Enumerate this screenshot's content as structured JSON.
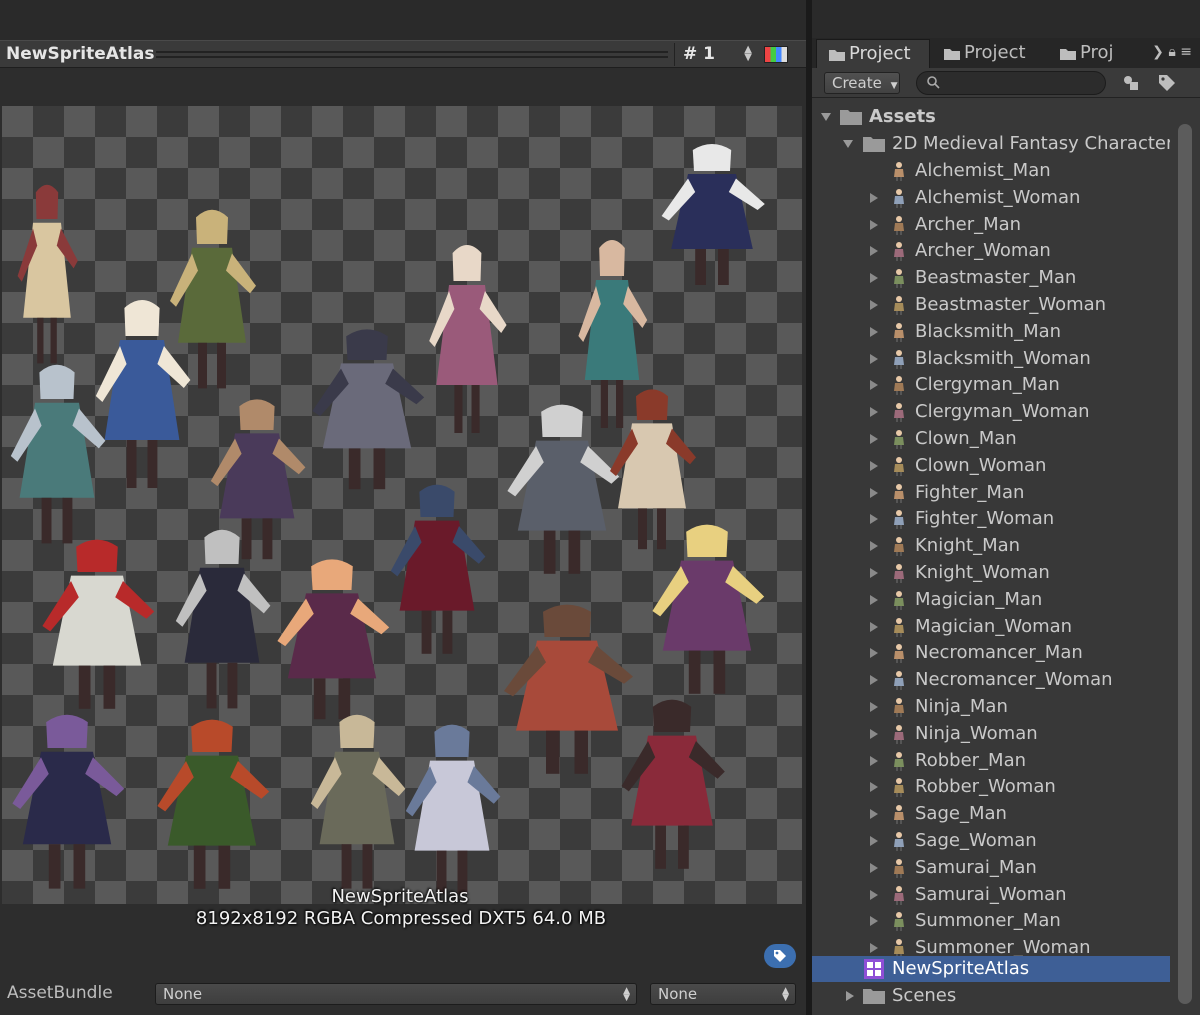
{
  "preview": {
    "title": "NewSpriteAtlas",
    "page": "# 1",
    "atlas_name": "NewSpriteAtlas",
    "atlas_info": "8192x8192 RGBA Compressed DXT5   64.0 MB"
  },
  "asset_bundle": {
    "label": "AssetBundle",
    "name_value": "None",
    "variant_value": "None"
  },
  "project": {
    "tabs": [
      {
        "label": "Project"
      },
      {
        "label": "Project"
      },
      {
        "label": "Proj"
      }
    ],
    "create_label": "Create",
    "tree": {
      "root": "Assets",
      "folder": "2D Medieval Fantasy Character",
      "characters": [
        "Alchemist_Man",
        "Alchemist_Woman",
        "Archer_Man",
        "Archer_Woman",
        "Beastmaster_Man",
        "Beastmaster_Woman",
        "Blacksmith_Man",
        "Blacksmith_Woman",
        "Clergyman_Man",
        "Clergyman_Woman",
        "Clown_Man",
        "Clown_Woman",
        "Fighter_Man",
        "Fighter_Woman",
        "Knight_Man",
        "Knight_Woman",
        "Magician_Man",
        "Magician_Woman",
        "Necromancer_Man",
        "Necromancer_Woman",
        "Ninja_Man",
        "Ninja_Woman",
        "Robber_Man",
        "Robber_Woman",
        "Sage_Man",
        "Sage_Woman",
        "Samurai_Man",
        "Samurai_Woman",
        "Summoner_Man",
        "Summoner_Woman"
      ],
      "atlas_item": "NewSpriteAtlas",
      "scenes": "Scenes"
    }
  },
  "colors": {
    "selection": "#3e5f96",
    "tag_button": "#3c6fb0",
    "atlas_icon": "#8e4fd6"
  }
}
